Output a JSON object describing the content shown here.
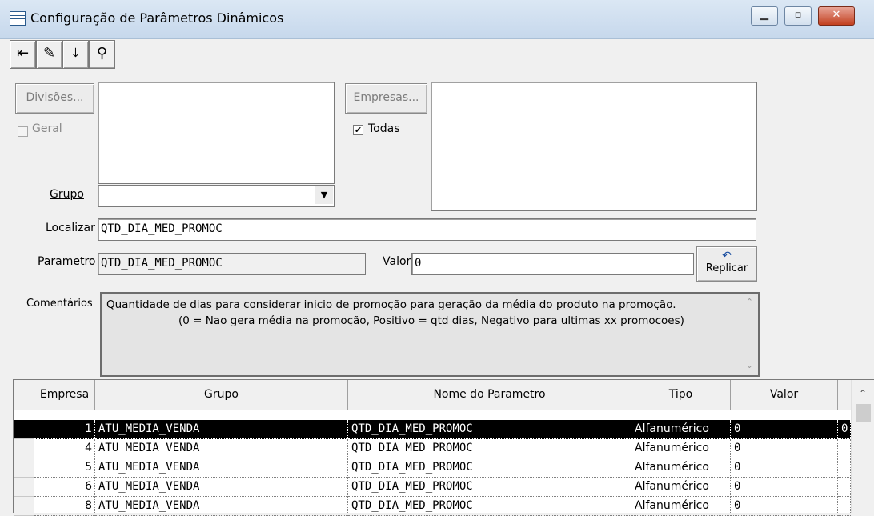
{
  "window": {
    "title": "Configuração de Parâmetros Dinâmicos",
    "minimize_glyph": "▁",
    "maximize_glyph": "▫",
    "close_glyph": "✕"
  },
  "toolbar": {
    "exit_icon": "⇤",
    "erase_icon": "✎",
    "save_icon": "⤓",
    "find_icon": "⚲"
  },
  "form": {
    "divisoes_button": "Divisões...",
    "geral_label": "Geral",
    "empresas_button": "Empresas...",
    "todas_label": "Todas",
    "todas_checked": true,
    "grupo_label": "Grupo",
    "grupo_value": "",
    "localizar_label": "Localizar",
    "localizar_value": "QTD_DIA_MED_PROMOC",
    "parametro_label": "Parametro",
    "parametro_value": "QTD_DIA_MED_PROMOC",
    "valor_label": "Valor",
    "valor_value": "0",
    "replicar_icon": "↶",
    "replicar_label": "Replicar",
    "comentarios_label": "Comentários",
    "comentarios_line1": "Quantidade de dias para considerar inicio de promoção para geração da média do produto na promoção.",
    "comentarios_line2": "(0 = Nao gera média na promoção, Positivo = qtd dias, Negativo para ultimas xx promocoes)"
  },
  "grid": {
    "headers": [
      "Empresa",
      "Grupo",
      "Nome do Parametro",
      "Tipo",
      "Valor"
    ],
    "rows": [
      {
        "empresa": "1",
        "grupo": "ATU_MEDIA_VENDA",
        "nome": "QTD_DIA_MED_PROMOC",
        "tipo": "Alfanumérico",
        "valor": "0",
        "extra": "0",
        "selected": true
      },
      {
        "empresa": "4",
        "grupo": "ATU_MEDIA_VENDA",
        "nome": "QTD_DIA_MED_PROMOC",
        "tipo": "Alfanumérico",
        "valor": "0",
        "extra": "",
        "selected": false
      },
      {
        "empresa": "5",
        "grupo": "ATU_MEDIA_VENDA",
        "nome": "QTD_DIA_MED_PROMOC",
        "tipo": "Alfanumérico",
        "valor": "0",
        "extra": "",
        "selected": false
      },
      {
        "empresa": "6",
        "grupo": "ATU_MEDIA_VENDA",
        "nome": "QTD_DIA_MED_PROMOC",
        "tipo": "Alfanumérico",
        "valor": "0",
        "extra": "",
        "selected": false
      },
      {
        "empresa": "8",
        "grupo": "ATU_MEDIA_VENDA",
        "nome": "QTD_DIA_MED_PROMOC",
        "tipo": "Alfanumérico",
        "valor": "0",
        "extra": "",
        "selected": false
      }
    ]
  }
}
